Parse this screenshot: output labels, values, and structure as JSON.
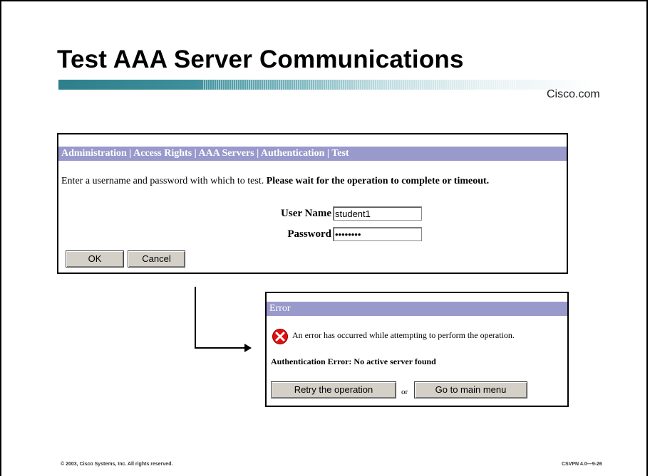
{
  "slide": {
    "title": "Test AAA Server Communications",
    "brand": "Cisco.com",
    "footer_left": "© 2003, Cisco Systems, Inc. All rights reserved.",
    "footer_right": "CSVPN 4.0—9-26"
  },
  "test_panel": {
    "breadcrumb": "Administration | Access Rights | AAA Servers | Authentication | Test",
    "instruction_plain": "Enter a username and password with which to test. ",
    "instruction_bold": "Please wait for the operation to complete or timeout.",
    "username_label": "User Name",
    "username_value": "student1",
    "password_label": "Password",
    "password_value": "********",
    "ok_label": "OK",
    "cancel_label": "Cancel"
  },
  "error_panel": {
    "header": "Error",
    "icon": "error-x-icon",
    "message": "An error has occurred while attempting to perform the operation.",
    "auth_error": "Authentication Error: No active server found",
    "retry_label": "Retry the operation",
    "or_text": "or",
    "main_menu_label": "Go to main menu"
  },
  "colors": {
    "panel_header": "#9999cc",
    "accent_teal": "#2d7f8c",
    "error_red": "#e01010"
  }
}
